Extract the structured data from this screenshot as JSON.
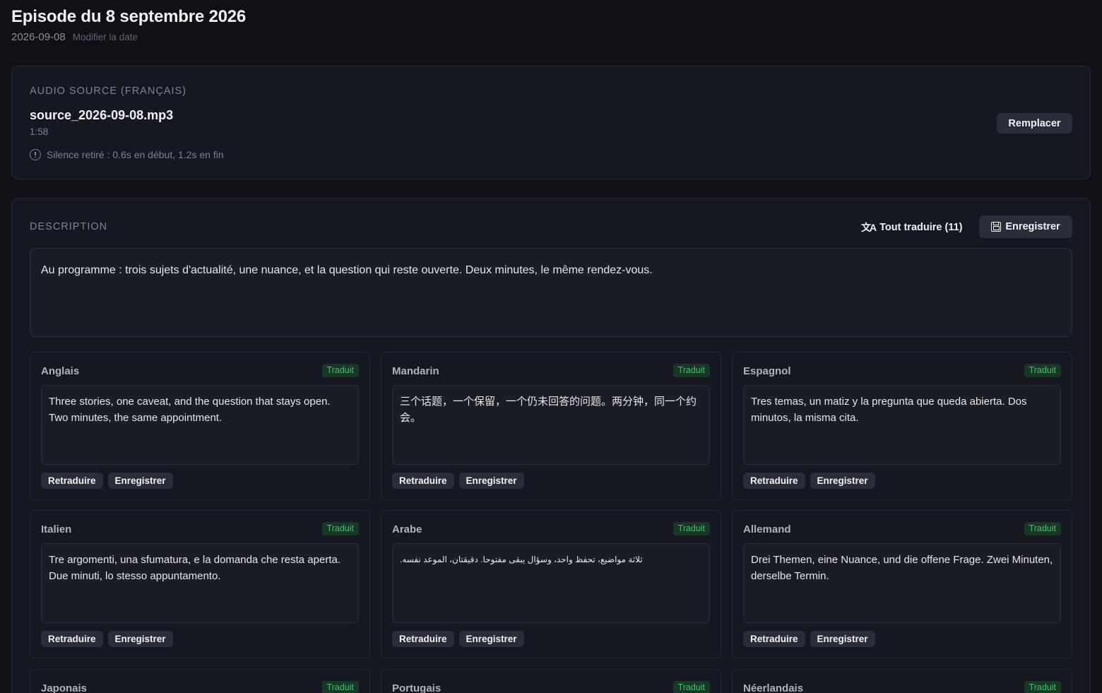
{
  "episode": {
    "title": "Episode du 8 septembre 2026",
    "date": "2026-09-08",
    "edit_date_label": "Modifier la date"
  },
  "audio": {
    "section_label": "AUDIO SOURCE (FRANÇAIS)",
    "file_name": "source_2026-09-08.mp3",
    "duration": "1:58",
    "silence_note": "Silence retiré : 0.6s en début, 1.2s en fin",
    "replace_label": "Remplacer",
    "icon": "info-icon"
  },
  "description": {
    "section_label": "DESCRIPTION",
    "translate_all_label": "Tout traduire (11)",
    "save_label": "Enregistrer",
    "text": "Au programme : trois sujets d'actualité, une nuance, et la question qui reste ouverte. Deux minutes, le même rendez-vous."
  },
  "languages": [
    {
      "name": "Anglais",
      "status": "Traduit",
      "text": "Three stories, one caveat, and the question that stays open. Two minutes, the same appointment.",
      "retranslate": "Retraduire",
      "save": "Enregistrer"
    },
    {
      "name": "Mandarin",
      "status": "Traduit",
      "text": "三个话题，一个保留，一个仍未回答的问题。两分钟，同一个约会。",
      "retranslate": "Retraduire",
      "save": "Enregistrer"
    },
    {
      "name": "Espagnol",
      "status": "Traduit",
      "text": "Tres temas, un matiz y la pregunta que queda abierta. Dos minutos, la misma cita.",
      "retranslate": "Retraduire",
      "save": "Enregistrer"
    },
    {
      "name": "Italien",
      "status": "Traduit",
      "text": "Tre argomenti, una sfumatura, e la domanda che resta aperta. Due minuti, lo stesso appuntamento.",
      "retranslate": "Retraduire",
      "save": "Enregistrer"
    },
    {
      "name": "Arabe",
      "status": "Traduit",
      "text": "ثلاثة مواضيع، تحفظ واحد، وسؤال يبقى مفتوحا. دقيقتان، الموعد نفسه.",
      "retranslate": "Retraduire",
      "save": "Enregistrer"
    },
    {
      "name": "Allemand",
      "status": "Traduit",
      "text": "Drei Themen, eine Nuance, und die offene Frage. Zwei Minuten, derselbe Termin.",
      "retranslate": "Retraduire",
      "save": "Enregistrer"
    },
    {
      "name": "Japonais",
      "status": "Traduit"
    },
    {
      "name": "Portugais",
      "status": "Traduit"
    },
    {
      "name": "Néerlandais",
      "status": "Traduit"
    }
  ]
}
